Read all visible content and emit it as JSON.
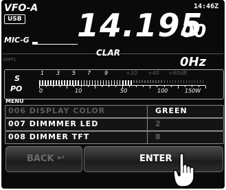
{
  "vfo_label": "VFO-A",
  "mode_badge": "USB",
  "clock": "14:46Z",
  "frequency": "14.195",
  "frequency_fine": "00",
  "mic_gain_label": "MIC-G",
  "mic_gain_level": 0.12,
  "clar_label": "CLAR",
  "clar_value": "0Hz",
  "amp_label": "AMP1",
  "meter": {
    "s_label": "S",
    "po_label": "PO",
    "s_scale": [
      "1",
      "3",
      "5",
      "7",
      "9",
      "+20",
      "+40",
      "+60dB"
    ],
    "po_scale": [
      "0",
      "10",
      "50",
      "100",
      "150W"
    ],
    "s_level": 0.56
  },
  "menu": {
    "title": "MENU",
    "items": [
      {
        "name": "006 DISPLAY COLOR",
        "value": "GREEN"
      },
      {
        "name": "007 DIMMMER LED",
        "value": "2"
      },
      {
        "name": "008 DIMMER TFT",
        "value": "8"
      }
    ]
  },
  "buttons": {
    "back": "BACK",
    "enter": "ENTER"
  },
  "colors": {
    "background": "#0a0a0a",
    "text": "#ffffff",
    "dim_text": "#5c5c5c"
  }
}
